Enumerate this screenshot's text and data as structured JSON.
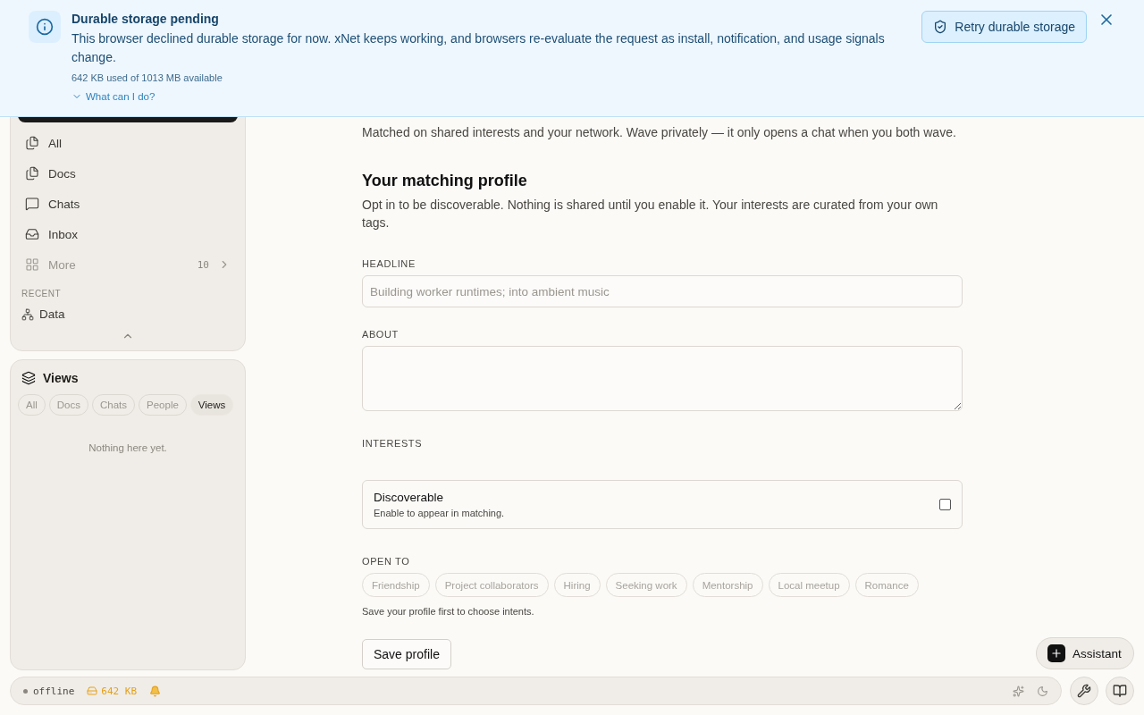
{
  "banner": {
    "title": "Durable storage pending",
    "message": "This browser declined durable storage for now. xNet keeps working, and browsers re-evaluate the request as install, notification, and usage signals change.",
    "usage": "642 KB used of 1013 MB available",
    "help_link": {
      "label": "What can I do?",
      "expanded": false
    },
    "retry_button": "Retry durable storage"
  },
  "sidebar": {
    "nav": [
      {
        "label": "All",
        "muted": false
      },
      {
        "label": "Docs",
        "muted": false
      },
      {
        "label": "Chats",
        "muted": false
      },
      {
        "label": "Inbox",
        "muted": false
      },
      {
        "label": "More",
        "muted": true,
        "count": "10"
      }
    ],
    "recent_heading": "RECENT",
    "recent": [
      {
        "label": "Data"
      }
    ]
  },
  "views_panel": {
    "title": "Views",
    "filters": [
      {
        "label": "All",
        "selected": false
      },
      {
        "label": "Docs",
        "selected": false
      },
      {
        "label": "Chats",
        "selected": false
      },
      {
        "label": "People",
        "selected": false
      },
      {
        "label": "Views",
        "selected": true
      }
    ],
    "empty": "Nothing here yet."
  },
  "main": {
    "intro": "Matched on shared interests and your network. Wave privately — it only opens a chat when you both wave.",
    "profile_title": "Your matching profile",
    "profile_desc": "Opt in to be discoverable. Nothing is shared until you enable it. Your interests are curated from your own tags.",
    "headline": {
      "label": "HEADLINE",
      "placeholder": "Building worker runtimes; into ambient music"
    },
    "about": {
      "label": "ABOUT"
    },
    "interests": {
      "label": "INTERESTS"
    },
    "discoverable": {
      "title": "Discoverable",
      "hint": "Enable to appear in matching.",
      "checked": false
    },
    "open_to": {
      "label": "OPEN TO",
      "disabled": true,
      "options": [
        {
          "label": "Friendship",
          "selected": false
        },
        {
          "label": "Project collaborators",
          "selected": false
        },
        {
          "label": "Hiring",
          "selected": false
        },
        {
          "label": "Seeking work",
          "selected": false
        },
        {
          "label": "Mentorship",
          "selected": false
        },
        {
          "label": "Local meetup",
          "selected": false
        },
        {
          "label": "Romance",
          "selected": false
        }
      ],
      "note": "Save your profile first to choose intents."
    },
    "save_button": "Save profile"
  },
  "assistant_button": "Assistant",
  "status_bar": {
    "connection": "offline",
    "storage": "642 KB"
  }
}
